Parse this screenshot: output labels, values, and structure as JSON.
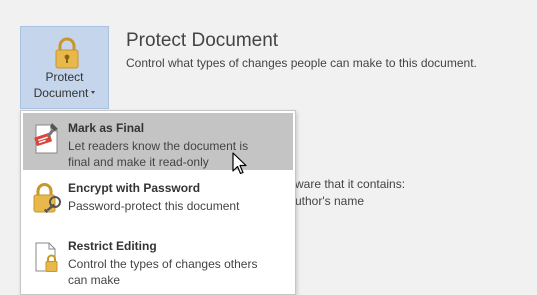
{
  "protect_button": {
    "label_line1": "Protect",
    "label_line2": "Document",
    "icon": "lock-icon"
  },
  "section": {
    "title": "Protect Document",
    "description": "Control what types of changes people can make to this document."
  },
  "background_text": {
    "line1": "ware that it contains:",
    "line2": "uthor's name"
  },
  "menu": {
    "items": [
      {
        "title": "Mark as Final",
        "description": "Let readers know the document is final and make it read-only",
        "icon": "mark-final-icon",
        "highlighted": true
      },
      {
        "title": "Encrypt with Password",
        "description": "Password-protect this document",
        "icon": "lock-key-icon",
        "highlighted": false
      },
      {
        "title": "Restrict Editing",
        "description": "Control the types of changes others can make",
        "icon": "restrict-document-icon",
        "highlighted": false
      }
    ]
  },
  "colors": {
    "background": "#f1f1f1",
    "button_selected": "#c5d6ec",
    "menu_highlight": "#c4c4c4",
    "lock_gold": "#e8b84a"
  }
}
